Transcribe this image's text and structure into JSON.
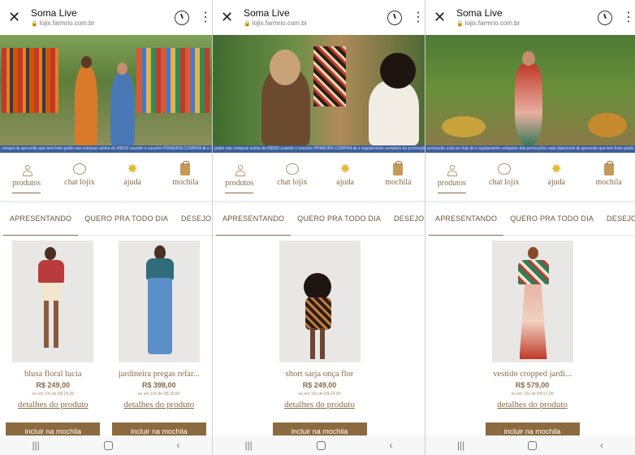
{
  "screens": [
    {
      "browser": {
        "title": "Soma Live",
        "url": "lojix.farmrio.com.br"
      },
      "ticker": "compra ✿ aproveite que tem frete grátis nas compras acima de R$500 usando o voucher PRIMEIRA COMPRA ✿ o regulamento completo da promoção está em lojix.farmrio.com.br",
      "tabs": [
        {
          "label": "produtos",
          "active": true
        },
        {
          "label": "chat lojix",
          "active": false
        },
        {
          "label": "ajuda",
          "active": false
        },
        {
          "label": "mochila",
          "active": false
        }
      ],
      "segments": [
        {
          "label": "APRESENTANDO",
          "active": true
        },
        {
          "label": "QUERO PRA TODO DIA",
          "active": false
        },
        {
          "label": "DESEJOS",
          "active": false
        }
      ],
      "products": [
        {
          "name": "blusa floral lucia",
          "price": "R$ 249,00",
          "installments": "ou em 10x de R$ 24,90",
          "details": "detalhes do produto",
          "cta": "incluir na mochila"
        },
        {
          "name": "jardineira pregas refar...",
          "price": "R$ 398,00",
          "installments": "ou em 10x de R$ 39,80",
          "details": "detalhes do produto",
          "cta": "incluir na mochila"
        }
      ]
    },
    {
      "browser": {
        "title": "Soma Live",
        "url": "lojix.farmrio.com.br"
      },
      "ticker": "grátis nas compras acima de R$500 usando o voucher PRIMEIRA COMPRA ✿ o regulamento completo da promoção está em lojix ✿ aproveite",
      "tabs": [
        {
          "label": "produtos",
          "active": true
        },
        {
          "label": "chat lojix",
          "active": false
        },
        {
          "label": "ajuda",
          "active": false
        },
        {
          "label": "mochila",
          "active": false
        }
      ],
      "segments": [
        {
          "label": "APRESENTANDO",
          "active": true
        },
        {
          "label": "QUERO PRA TODO DIA",
          "active": false
        },
        {
          "label": "DESEJOS",
          "active": false
        }
      ],
      "products": [
        {
          "name": "short sarja onça flor",
          "price": "R$ 249,00",
          "installments": "ou em 10x de R$ 24,90",
          "details": "detalhes do produto",
          "cta": "incluir na mochila"
        }
      ]
    },
    {
      "browser": {
        "title": "Soma Live",
        "url": "lojix.farmrio.com.br"
      },
      "ticker": "promoção está em lojix ✿ o regulamento completo das promoções está disponível ✿ aproveite que tem frete grátis",
      "tabs": [
        {
          "label": "produtos",
          "active": true
        },
        {
          "label": "chat lojix",
          "active": false
        },
        {
          "label": "ajuda",
          "active": false
        },
        {
          "label": "mochila",
          "active": false
        }
      ],
      "segments": [
        {
          "label": "APRESENTANDO",
          "active": true
        },
        {
          "label": "QUERO PRA TODO DIA",
          "active": false
        },
        {
          "label": "DESEJOS",
          "active": false
        }
      ],
      "products": [
        {
          "name": "vestido cropped jardi...",
          "price": "R$ 579,00",
          "installments": "ou em 10x de R$ 57,90",
          "details": "detalhes do produto",
          "cta": "incluir na mochila"
        }
      ]
    }
  ],
  "icons": {
    "close": "close-icon",
    "lock": "lock-icon",
    "timer": "timer-icon",
    "menu": "kebab-menu-icon",
    "produtos": "person-icon",
    "chat": "chat-bubble-icon",
    "ajuda": "sun-icon",
    "mochila": "backpack-icon",
    "nav": [
      "recent-apps-icon",
      "home-icon",
      "back-icon"
    ]
  },
  "colors": {
    "brand": "#8a6a46",
    "button": "#8c6a3f",
    "ticker": "#3d5f9a"
  }
}
